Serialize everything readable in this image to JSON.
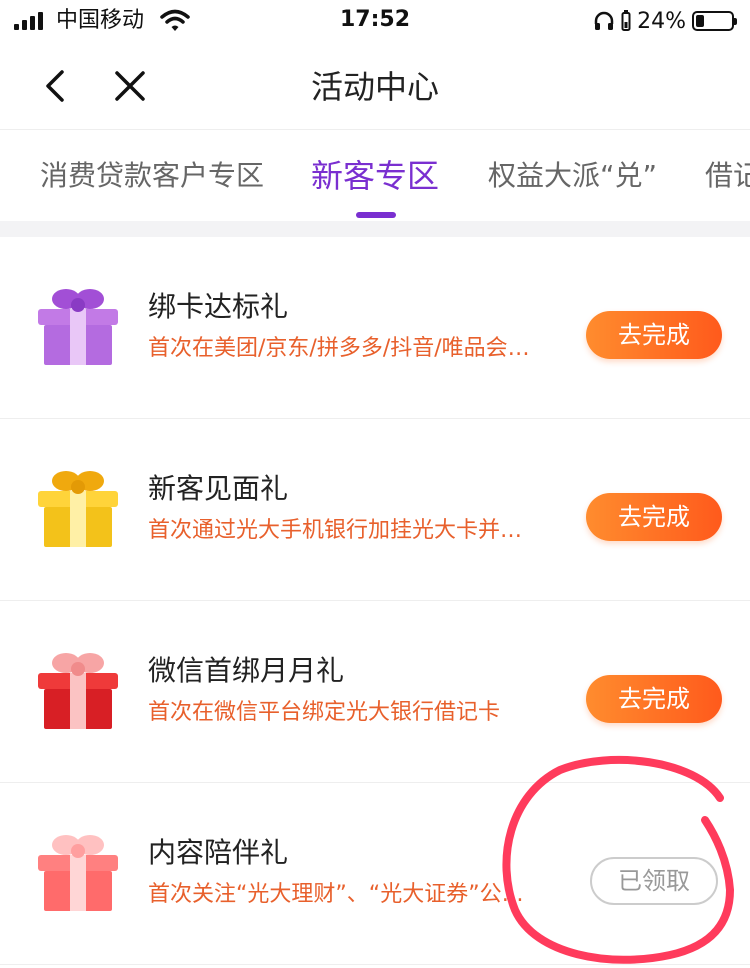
{
  "status_bar": {
    "carrier": "中国移动",
    "time": "17:52",
    "battery_percent": "24%",
    "battery_level": 0.24
  },
  "nav": {
    "title": "活动中心",
    "back_icon": "chevron-left-icon",
    "close_icon": "close-icon"
  },
  "tabs": [
    {
      "label": "消费贷款客户专区",
      "active": false
    },
    {
      "label": "新客专区",
      "active": true
    },
    {
      "label": "权益大派“兑”",
      "active": false
    },
    {
      "label": "借记",
      "active": false
    }
  ],
  "tasks": [
    {
      "title": "绑卡达标礼",
      "desc": "首次在美团/京东/拼多多/抖音/唯品会绑卡",
      "button": "去完成",
      "status": "todo",
      "gift_color": "#b46be0"
    },
    {
      "title": "新客见面礼",
      "desc": "首次通过光大手机银行加挂光大卡并激活",
      "button": "去完成",
      "status": "todo",
      "gift_color": "#f3c21a"
    },
    {
      "title": "微信首绑月月礼",
      "desc": "首次在微信平台绑定光大银行借记卡",
      "button": "去完成",
      "status": "todo",
      "gift_color": "#e8262a"
    },
    {
      "title": "内容陪伴礼",
      "desc": "首次关注“光大理财”、“光大证券”公众号",
      "button": "已领取",
      "status": "done",
      "gift_color": "#ff6b6b"
    }
  ],
  "colors": {
    "accent": "#7a2fd0",
    "button_gradient_start": "#ff8c2e",
    "button_gradient_end": "#ff5a1c",
    "desc_text": "#e8602c",
    "annotation_stroke": "#ff3b5c"
  }
}
